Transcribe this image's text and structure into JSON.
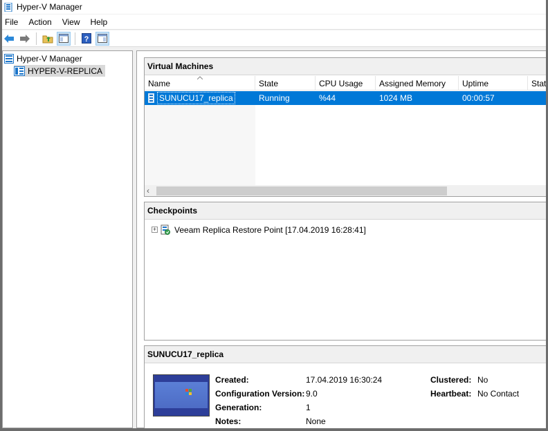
{
  "window": {
    "title": "Hyper-V Manager"
  },
  "menubar": {
    "items": [
      "File",
      "Action",
      "View",
      "Help"
    ]
  },
  "toolbar": {
    "buttons": [
      "back-arrow-icon",
      "forward-arrow-icon",
      "up-folder-icon",
      "show-hide-tree-icon",
      "help-icon",
      "show-hide-action-pane-icon"
    ]
  },
  "tree": {
    "root": "Hyper-V Manager",
    "child": "HYPER-V-REPLICA"
  },
  "vm_panel": {
    "title": "Virtual Machines",
    "columns": [
      "Name",
      "State",
      "CPU Usage",
      "Assigned Memory",
      "Uptime",
      "Stat"
    ],
    "rows": [
      {
        "name": "SUNUCU17_replica",
        "state": "Running",
        "cpu": "%44",
        "memory": "1024 MB",
        "uptime": "00:00:57"
      }
    ]
  },
  "checkpoint_panel": {
    "title": "Checkpoints",
    "items": [
      "Veeam Replica Restore Point [17.04.2019 16:28:41]"
    ]
  },
  "details_panel": {
    "title": "SUNUCU17_replica",
    "created_label": "Created:",
    "created_value": "17.04.2019 16:30:24",
    "config_label": "Configuration Version:",
    "config_value": "9.0",
    "generation_label": "Generation:",
    "generation_value": "1",
    "notes_label": "Notes:",
    "notes_value": "None",
    "clustered_label": "Clustered:",
    "clustered_value": "No",
    "heartbeat_label": "Heartbeat:",
    "heartbeat_value": "No Contact"
  },
  "colors": {
    "selection": "#0078d7",
    "tree_selection": "#d9d9d9"
  }
}
